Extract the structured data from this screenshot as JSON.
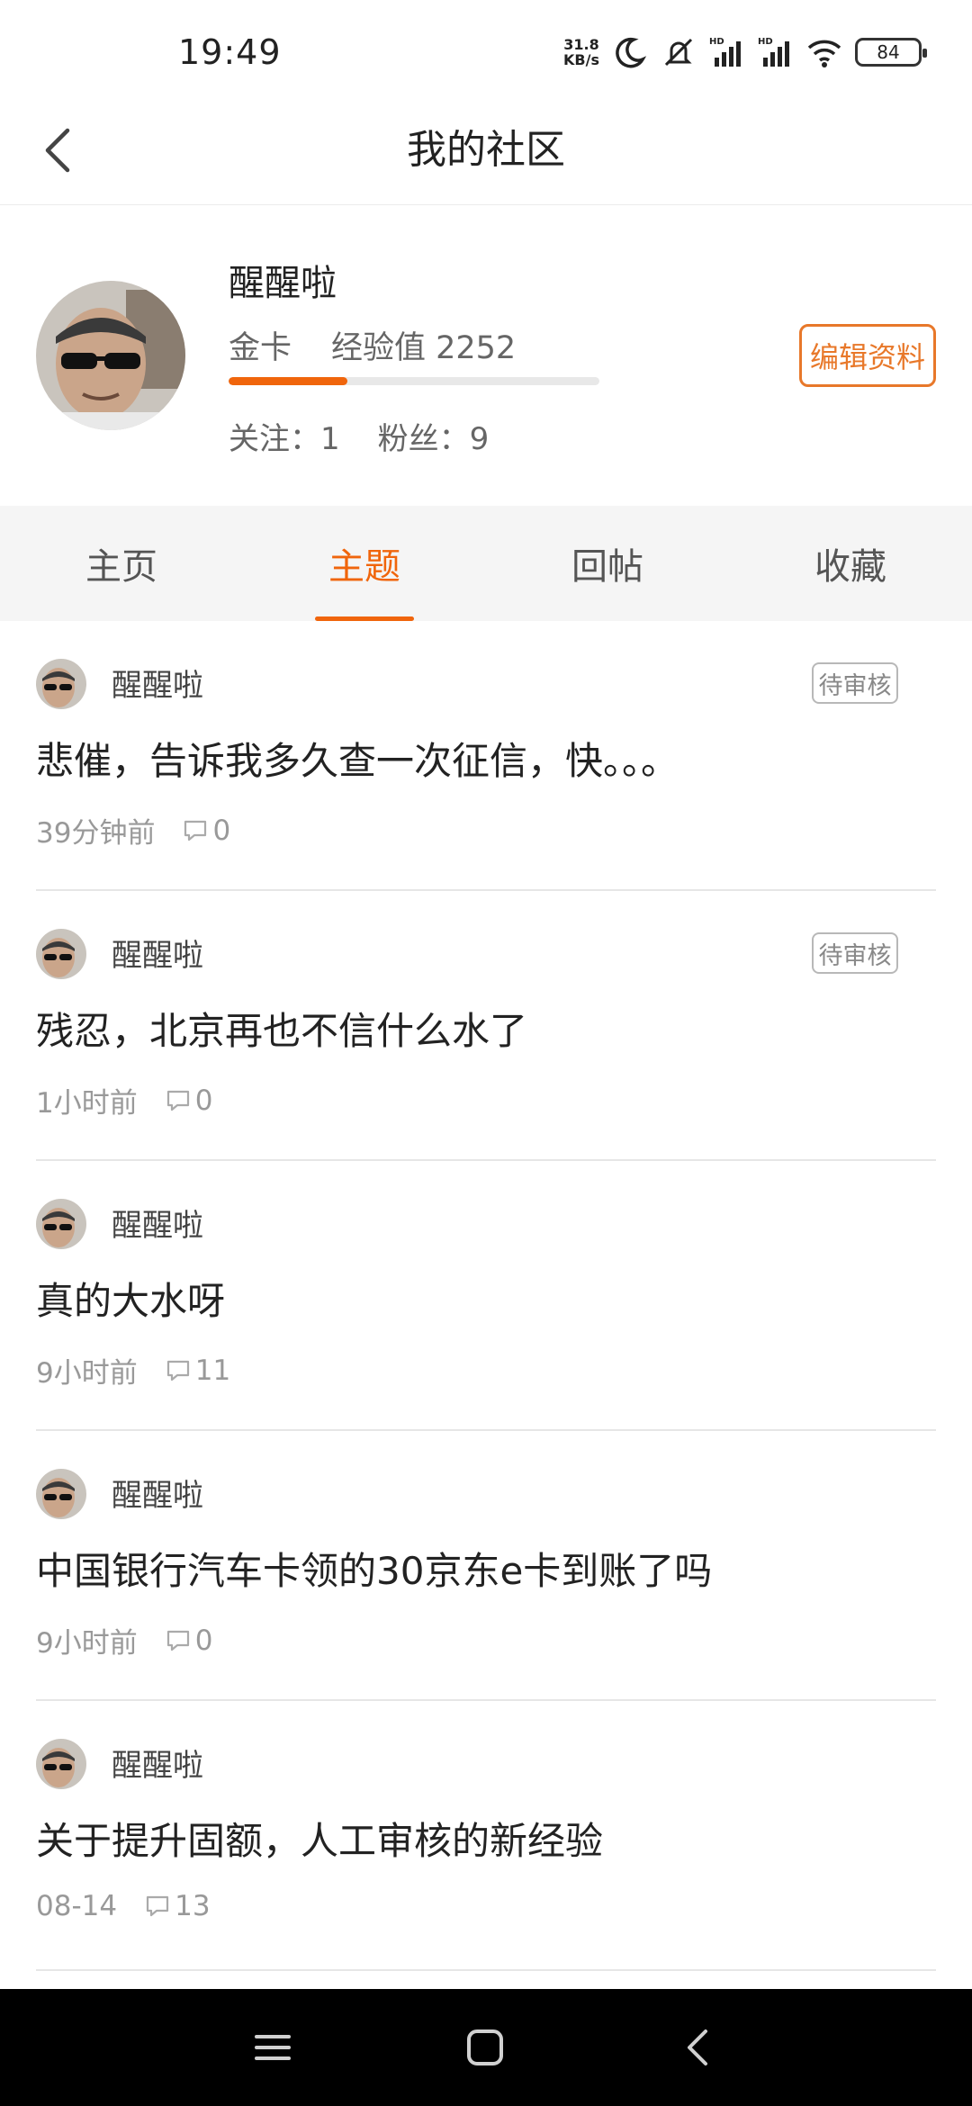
{
  "status_bar": {
    "time": "19:49",
    "speed_value": "31.8",
    "speed_unit": "KB/s",
    "icons": [
      "moon-icon",
      "mute-icon",
      "hd-signal-icon",
      "hd-signal-icon",
      "wifi-icon"
    ],
    "battery": "84"
  },
  "header": {
    "title": "我的社区",
    "back_icon": "chevron-left-icon"
  },
  "profile": {
    "name": "醒醒啦",
    "level": "金卡",
    "exp_label": "经验值 2252",
    "exp_progress_fraction": 0.32,
    "follow_label": "关注：1",
    "fans_label": "粉丝：9",
    "edit_button": "编辑资料"
  },
  "tabs": [
    {
      "label": "主页",
      "active": false
    },
    {
      "label": "主题",
      "active": true
    },
    {
      "label": "回帖",
      "active": false
    },
    {
      "label": "收藏",
      "active": false
    }
  ],
  "posts": [
    {
      "author": "醒醒啦",
      "badge": "待审核",
      "title": "悲催，告诉我多久查一次征信，快。。。",
      "time": "39分钟前",
      "comments": "0"
    },
    {
      "author": "醒醒啦",
      "badge": "待审核",
      "title": "残忍，北京再也不信什么水了",
      "time": "1小时前",
      "comments": "0"
    },
    {
      "author": "醒醒啦",
      "badge": "",
      "title": "真的大水呀",
      "time": "9小时前",
      "comments": "11"
    },
    {
      "author": "醒醒啦",
      "badge": "",
      "title": "中国银行汽车卡领的30京东e卡到账了吗",
      "time": "9小时前",
      "comments": "0"
    },
    {
      "author": "醒醒啦",
      "badge": "",
      "title": "关于提升固额，人工审核的新经验",
      "time": "08-14",
      "comments": "13"
    }
  ],
  "nav_bar": {
    "icons": [
      "menu-icon",
      "home-square-icon",
      "back-triangle-icon"
    ]
  },
  "colors": {
    "accent": "#f0650c",
    "edit_border": "#e8782a",
    "tab_bg": "#f5f5f5"
  }
}
